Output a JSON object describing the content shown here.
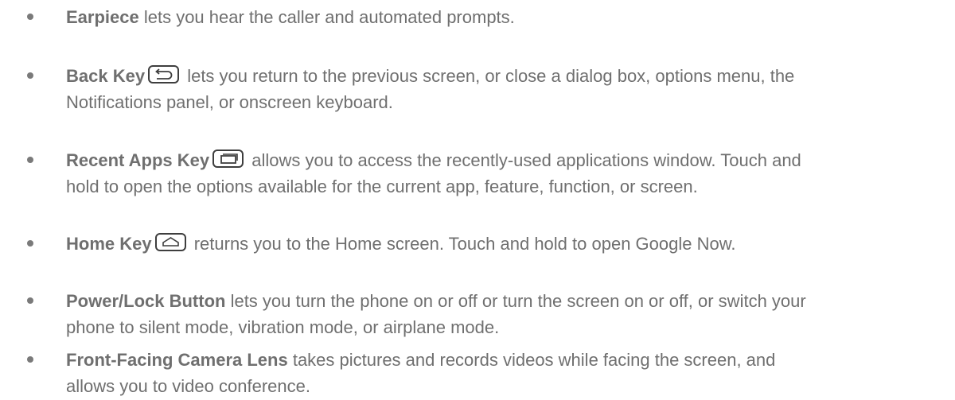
{
  "items": [
    {
      "term": "Earpiece",
      "line1": " lets you hear the caller and automated prompts."
    },
    {
      "term": "Back Key",
      "icon": "back-arrow-icon",
      "line1": " lets you return to the previous screen, or close a dialog box, options menu, the",
      "line2": "Notifications panel, or onscreen keyboard."
    },
    {
      "term": "Recent Apps Key",
      "icon": "recent-apps-icon",
      "line1": " allows you to access the recently-used applications window. Touch and",
      "line2": "hold to open the options available for the current app, feature, function, or screen."
    },
    {
      "term": "Home Key",
      "icon": "home-icon",
      "line1": " returns you to the Home screen. Touch and hold to open Google Now."
    },
    {
      "term": "Power/Lock Button",
      "line1": " lets you turn the phone on or off or turn the screen on or off, or switch your",
      "line2": "phone to silent mode, vibration mode, or airplane mode."
    },
    {
      "term": "Front-Facing Camera Lens",
      "line1": " takes pictures and records videos while facing the screen, and",
      "line2": "allows you to video conference."
    }
  ]
}
